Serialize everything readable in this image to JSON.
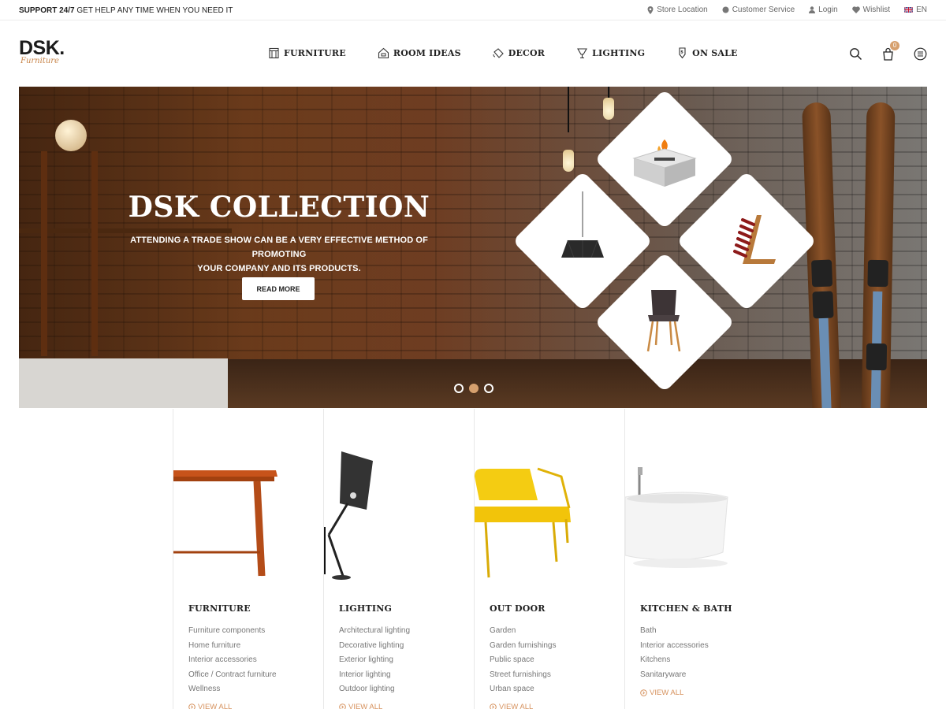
{
  "topbar": {
    "support_strong": "SUPPORT 24/7",
    "support_text": "GET HELP ANY TIME WHEN YOU NEED IT",
    "links": {
      "store": "Store Location",
      "service": "Customer Service",
      "login": "Login",
      "wishlist": "Wishlist",
      "lang": "EN"
    }
  },
  "logo": {
    "mark": "DSK.",
    "sub": "Furniture"
  },
  "nav": {
    "furniture": "FURNITURE",
    "room_ideas": "ROOM IDEAS",
    "decor": "DECOR",
    "lighting": "LIGHTING",
    "on_sale": "ON SALE"
  },
  "cart": {
    "count": "0"
  },
  "hero": {
    "title": "DSK COLLECTION",
    "subtitle_line1": "ATTENDING A TRADE SHOW CAN BE A VERY EFFECTIVE METHOD OF PROMOTING",
    "subtitle_line2": "YOUR COMPANY AND ITS PRODUCTS.",
    "button": "READ MORE",
    "active_slide": 2,
    "slides": 3
  },
  "categories": [
    {
      "title": "FURNITURE",
      "items": [
        "Furniture components",
        "Home furniture",
        "Interior accessories",
        "Office / Contract furniture",
        "Wellness"
      ],
      "view_all": "VIEW ALL"
    },
    {
      "title": "LIGHTING",
      "items": [
        "Architectural lighting",
        "Decorative lighting",
        "Exterior lighting",
        "Interior lighting",
        "Outdoor lighting"
      ],
      "view_all": "VIEW ALL"
    },
    {
      "title": "OUT DOOR",
      "items": [
        "Garden",
        "Garden furnishings",
        "Public space",
        "Street furnishings",
        "Urban space"
      ],
      "view_all": "VIEW ALL"
    },
    {
      "title": "KITCHEN & BATH",
      "items": [
        "Bath",
        "Interior accessories",
        "Kitchens",
        "Sanitaryware"
      ],
      "view_all": "VIEW ALL"
    }
  ],
  "colors": {
    "accent": "#d6a06e",
    "text": "#222222",
    "muted": "#777777"
  }
}
